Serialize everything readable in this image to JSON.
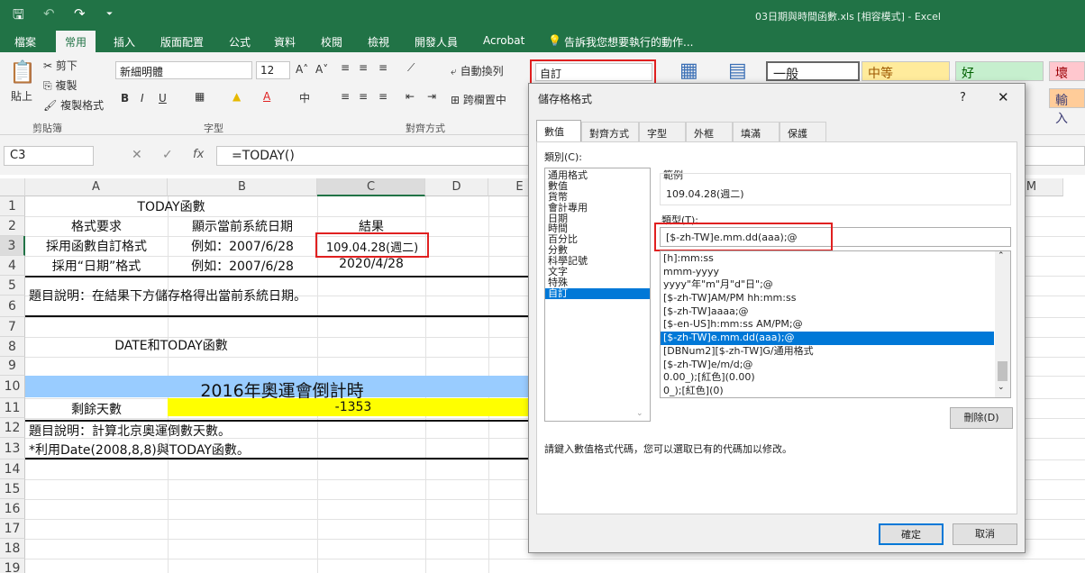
{
  "window": {
    "title": "03日期與時間函數.xls [相容模式] - Excel"
  },
  "qat": {
    "save": "🖫",
    "undo": "↶",
    "redo": "↷",
    "more": "⏷"
  },
  "ribbon_tabs": [
    "檔案",
    "常用",
    "插入",
    "版面配置",
    "公式",
    "資料",
    "校閱",
    "檢視",
    "開發人員",
    "Acrobat"
  ],
  "tellme": "告訴我您想要執行的動作...",
  "ribbon": {
    "clipboard": {
      "paste": "貼上",
      "cut": "剪下",
      "copy": "複製",
      "format_painter": "複製格式",
      "group": "剪貼簿"
    },
    "font": {
      "name": "新細明體",
      "size": "12",
      "group": "字型",
      "bold": "B",
      "italic": "I",
      "underline": "U"
    },
    "alignment": {
      "wrap": "自動換列",
      "merge": "跨欄置中",
      "group": "對齊方式"
    },
    "number": {
      "format": "自訂"
    },
    "styles": {
      "normal": "一般",
      "neutral": "中等",
      "good": "好",
      "bad": "壞",
      "input": "輸入"
    }
  },
  "formula_bar": {
    "name_box": "C3",
    "formula": "=TODAY()",
    "fx": "fx",
    "cancel": "✕",
    "enter": "✓"
  },
  "columns": [
    "A",
    "B",
    "C",
    "D",
    "E",
    "M"
  ],
  "rows": [
    "1",
    "2",
    "3",
    "4",
    "5",
    "6",
    "7",
    "8",
    "9",
    "10",
    "11",
    "12",
    "13",
    "14",
    "15",
    "16",
    "17",
    "18",
    "19"
  ],
  "cells": {
    "a1": "TODAY函數",
    "a2": "格式要求",
    "b2": "顯示當前系統日期",
    "c2": "結果",
    "a3": "採用函數自訂格式",
    "b3": "例如：2007/6/28",
    "c3": "109.04.28(週二)",
    "a4": "採用“日期”格式",
    "b4": "例如：2007/6/28",
    "c4": "2020/4/28",
    "a5": "題目說明：在結果下方儲存格得出當前系統日期。",
    "a8": "DATE和TODAY函數",
    "a10": "2016年奧運會倒計時",
    "a11": "剩餘天數",
    "c11": "-1353",
    "a12": "題目說明：計算北京奧運倒數天數。",
    "a13": "*利用Date(2008,8,8)與TODAY函數。"
  },
  "dialog": {
    "title": "儲存格格式",
    "help": "?",
    "close": "✕",
    "tabs": [
      "數值",
      "對齊方式",
      "字型",
      "外框",
      "填滿",
      "保護"
    ],
    "category_label": "類別(C):",
    "categories": [
      "通用格式",
      "數值",
      "貨幣",
      "會計專用",
      "日期",
      "時間",
      "百分比",
      "分數",
      "科學記號",
      "文字",
      "特殊",
      "自訂"
    ],
    "selected_category": "自訂",
    "sample_label": "範例",
    "sample_value": "109.04.28(週二)",
    "type_label": "類型(T):",
    "type_value": "[$-zh-TW]e.mm.dd(aaa);@",
    "formats": [
      "[h]:mm:ss",
      "mmm-yyyy",
      "yyyy\"年\"m\"月\"d\"日\";@",
      "[$-zh-TW]AM/PM hh:mm:ss",
      "[$-zh-TW]aaaa;@",
      "[$-en-US]h:mm:ss AM/PM;@",
      "[$-zh-TW]e.mm.dd(aaa);@",
      "[DBNum2][$-zh-TW]G/通用格式",
      "[$-zh-TW]e/m/d;@",
      "0.00_);[紅色](0.00)",
      "0_);[紅色](0)"
    ],
    "selected_format": "[$-zh-TW]e.mm.dd(aaa);@",
    "delete_button": "刪除(D)",
    "hint": "請鍵入數值格式代碼，您可以選取已有的代碼加以修改。",
    "ok": "確定",
    "cancel": "取消"
  },
  "colors": {
    "excel_green": "#217346",
    "blue_fill": "#99ccff",
    "yellow_fill": "#ffff00",
    "highlight_red": "#e02020",
    "select_blue": "#0078d7"
  }
}
